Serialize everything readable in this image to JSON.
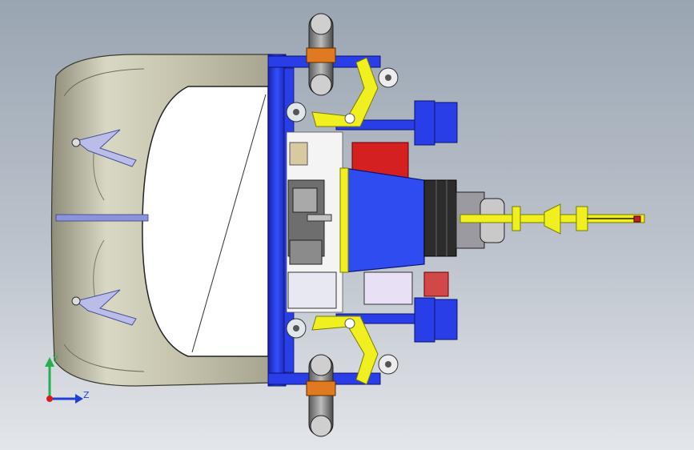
{
  "viewport": {
    "background_top": "#9aa5b2",
    "background_bottom": "#e3e6ea"
  },
  "triad": {
    "y_label": "Y",
    "z_label": "Z",
    "y_color": "#22b14c",
    "z_color": "#1f3fd6",
    "origin_color": "#d81c1c"
  },
  "colors": {
    "shell": "#c9c8b2",
    "frame_blue": "#1c2fd0",
    "yellow": "#f0f020",
    "red": "#d42020",
    "dark": "#2c2c2c",
    "steel": "#a0a8b0"
  }
}
